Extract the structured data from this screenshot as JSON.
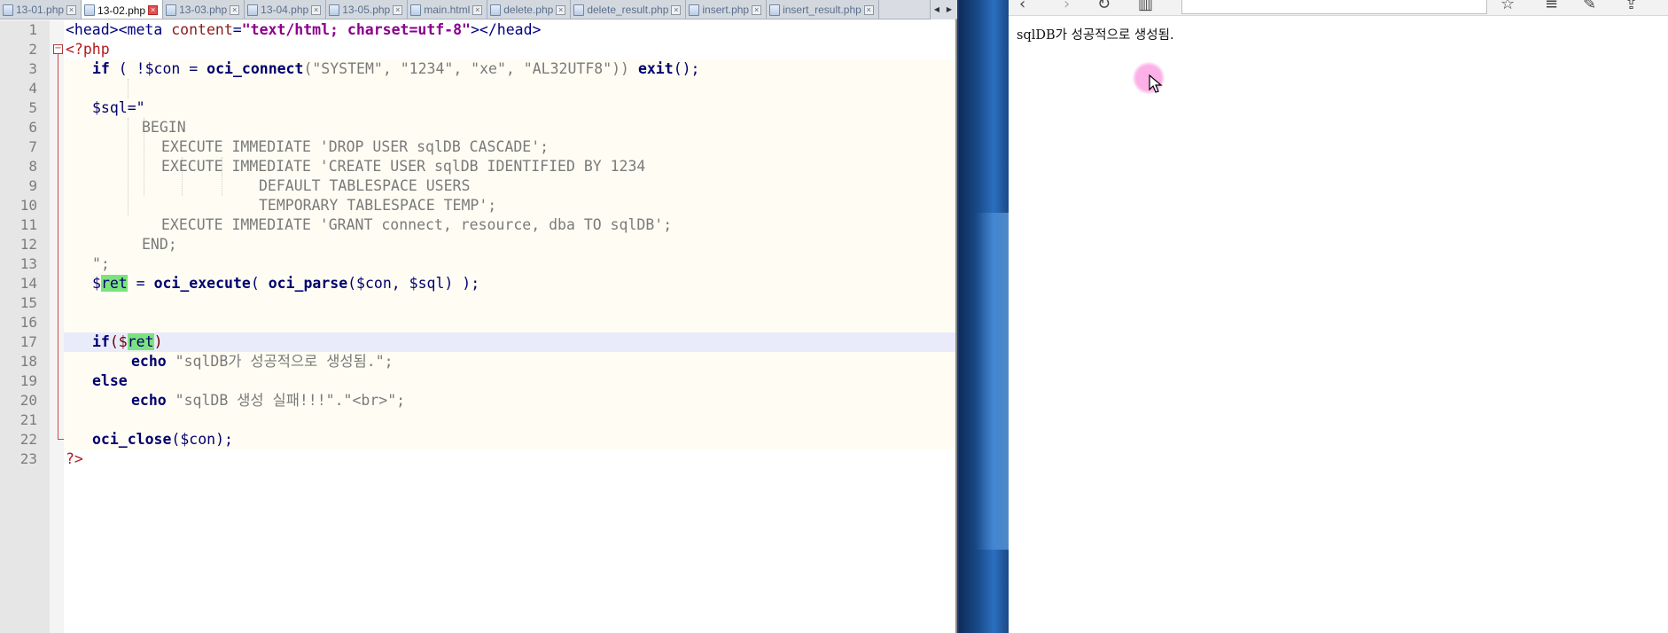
{
  "editor": {
    "tabs": [
      {
        "label": "13-01.php",
        "active": false
      },
      {
        "label": "13-02.php",
        "active": true
      },
      {
        "label": "13-03.php",
        "active": false
      },
      {
        "label": "13-04.php",
        "active": false
      },
      {
        "label": "13-05.php",
        "active": false
      },
      {
        "label": "main.html",
        "active": false
      },
      {
        "label": "delete.php",
        "active": false
      },
      {
        "label": "delete_result.php",
        "active": false
      },
      {
        "label": "insert.php",
        "active": false
      },
      {
        "label": "insert_result.php",
        "active": false
      }
    ],
    "line_numbers": [
      "1",
      "2",
      "3",
      "4",
      "5",
      "6",
      "7",
      "8",
      "9",
      "10",
      "11",
      "12",
      "13",
      "14",
      "15",
      "16",
      "17",
      "18",
      "19",
      "20",
      "21",
      "22",
      "23"
    ],
    "code": {
      "l1_a": "<head><meta ",
      "l1_b": "content",
      "l1_c": "=",
      "l1_d": "\"text/html; charset=utf-8\"",
      "l1_e": "></head>",
      "l2": "<?php",
      "l3_kw": "if",
      "l3_a": " ( !$con = ",
      "l3_fn": "oci_connect",
      "l3_b": "(\"SYSTEM\", \"1234\", \"xe\", \"AL32UTF8\")) ",
      "l3_exit": "exit",
      "l3_c": "();",
      "l5": "$sql=\"",
      "l6": "BEGIN",
      "l7": "EXECUTE IMMEDIATE 'DROP USER sqlDB CASCADE';",
      "l8": "EXECUTE IMMEDIATE 'CREATE USER sqlDB IDENTIFIED BY 1234",
      "l9": "DEFAULT TABLESPACE USERS",
      "l10": "TEMPORARY TABLESPACE TEMP';",
      "l11": "EXECUTE IMMEDIATE 'GRANT connect, resource, dba TO sqlDB';",
      "l12": "END;",
      "l13": "\";",
      "l14_a": "$",
      "l14_var": "ret",
      "l14_b": " = ",
      "l14_fn1": "oci_execute",
      "l14_c": "( ",
      "l14_fn2": "oci_parse",
      "l14_d": "($con, $sql) );",
      "l16_kw": "if",
      "l16_a": "($",
      "l16_var": "ret",
      "l16_b": ")",
      "l17_kw": "echo",
      "l17_str": " \"sqlDB가 성공적으로 생성됨.\";",
      "l18": "else",
      "l19_kw": "echo",
      "l19_str": " \"sqlDB 생성 실패!!!\".\"<br>\";",
      "l21_fn": "oci_close",
      "l21_a": "($con);",
      "l22": "?>"
    }
  },
  "browser": {
    "output_text": "sqlDB가 성공적으로 생성됨."
  }
}
